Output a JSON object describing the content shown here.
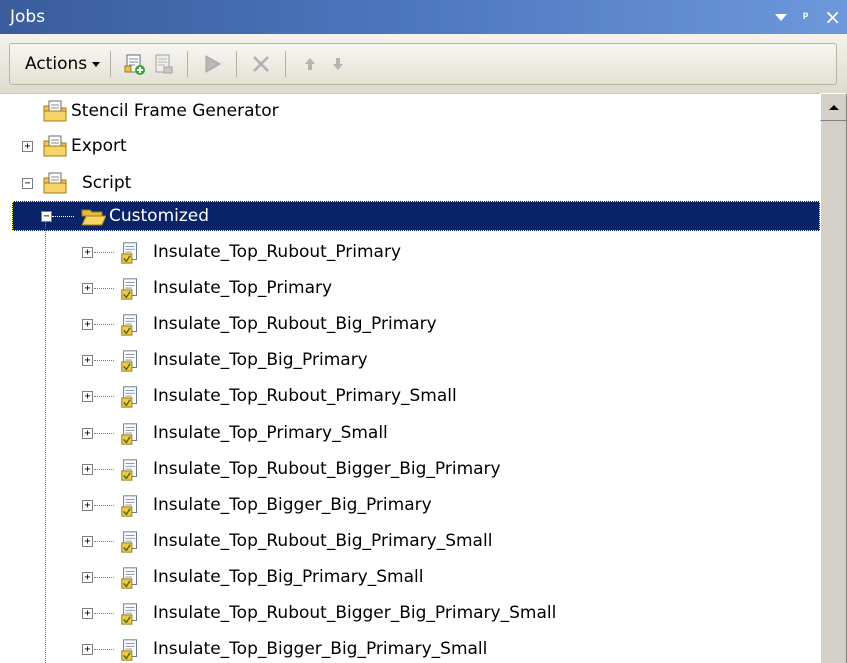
{
  "window": {
    "title": "Jobs",
    "controls": {
      "dropdown": "▾",
      "pin": "ᵖ",
      "close": "×"
    }
  },
  "toolbar": {
    "actions_label": "Actions",
    "buttons": [
      {
        "icon": "add-job-icon",
        "enabled": true
      },
      {
        "icon": "job-properties-icon",
        "enabled": false
      },
      {
        "icon": "run-icon",
        "enabled": false
      },
      {
        "icon": "delete-icon",
        "enabled": false
      },
      {
        "icon": "move-up-icon",
        "enabled": false
      },
      {
        "icon": "move-down-icon",
        "enabled": false
      }
    ]
  },
  "tree": {
    "root_items": [
      {
        "label": "Stencil Frame Generator",
        "icon": "folder-document-icon",
        "expandable": false
      },
      {
        "label": "Export",
        "icon": "folder-document-icon",
        "expandable": true,
        "expanded": false
      },
      {
        "label": "Script",
        "icon": "folder-document-icon",
        "expandable": true,
        "expanded": true
      },
      {
        "label": "Customized",
        "icon": "open-folder-icon",
        "expandable": true,
        "expanded": true,
        "selected": true
      }
    ],
    "scripts": [
      "Insulate_Top_Rubout_Primary",
      "Insulate_Top_Primary",
      "Insulate_Top_Rubout_Big_Primary",
      "Insulate_Top_Big_Primary",
      "Insulate_Top_Rubout_Primary_Small",
      "Insulate_Top_Primary_Small",
      "Insulate_Top_Rubout_Bigger_Big_Primary",
      "Insulate_Top_Bigger_Big_Primary",
      "Insulate_Top_Rubout_Big_Primary_Small",
      "Insulate_Top_Big_Primary_Small",
      "Insulate_Top_Rubout_Bigger_Big_Primary_Small",
      "Insulate_Top_Bigger_Big_Primary_Small"
    ]
  },
  "colors": {
    "titlebar": "#4a75bd",
    "selection": "#0a246a"
  }
}
